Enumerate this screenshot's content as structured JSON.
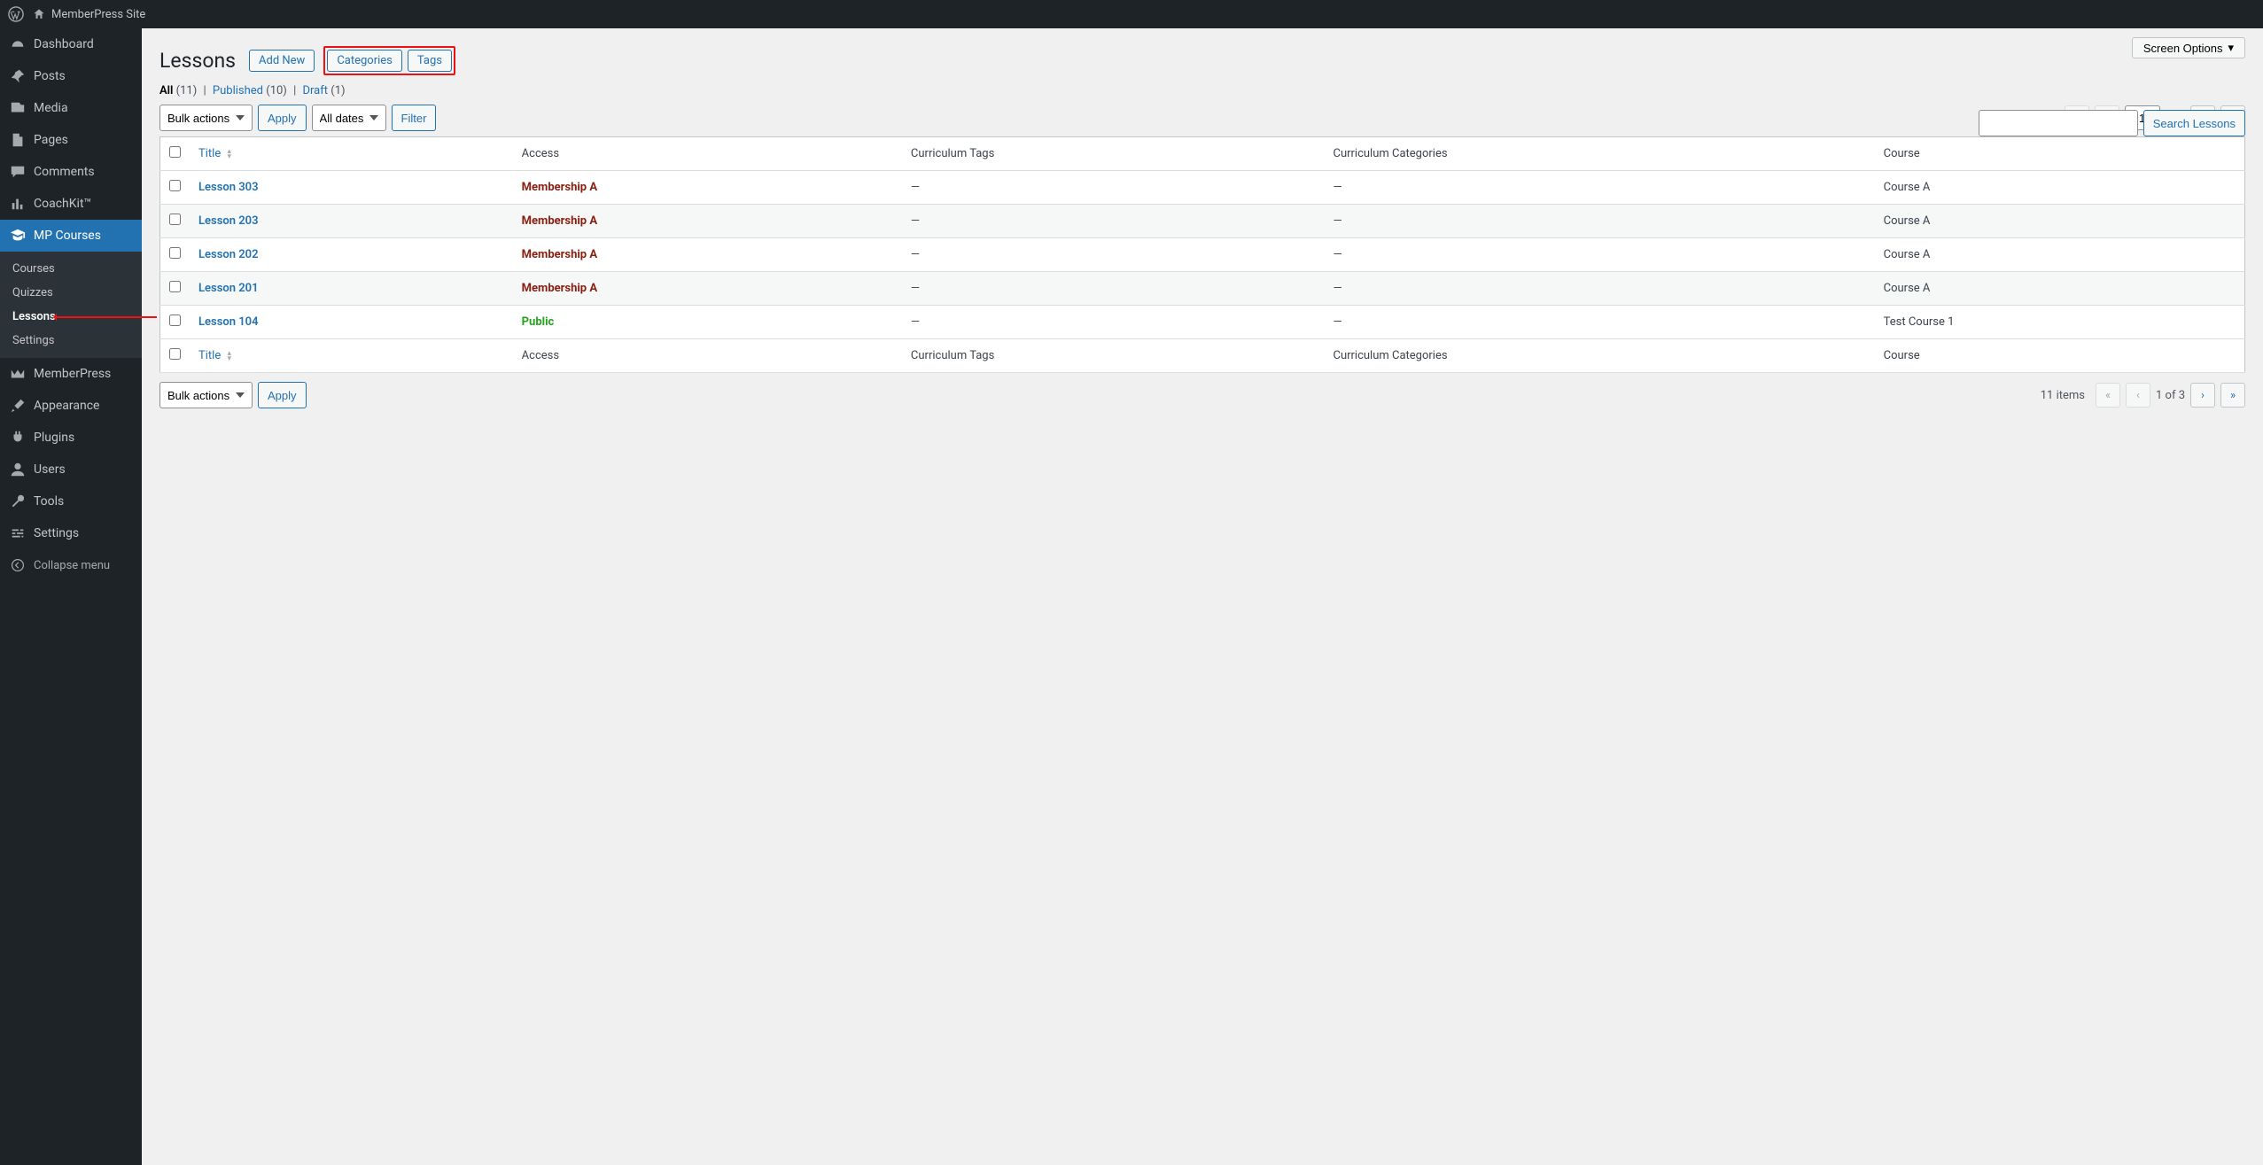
{
  "adminbar": {
    "site_name": "MemberPress Site"
  },
  "sidebar": {
    "items": [
      {
        "label": "Dashboard"
      },
      {
        "label": "Posts"
      },
      {
        "label": "Media"
      },
      {
        "label": "Pages"
      },
      {
        "label": "Comments"
      },
      {
        "label": "CoachKit™"
      },
      {
        "label": "MP Courses"
      },
      {
        "label": "MemberPress"
      },
      {
        "label": "Appearance"
      },
      {
        "label": "Plugins"
      },
      {
        "label": "Users"
      },
      {
        "label": "Tools"
      },
      {
        "label": "Settings"
      }
    ],
    "submenu": {
      "courses": "Courses",
      "quizzes": "Quizzes",
      "lessons": "Lessons",
      "settings": "Settings"
    },
    "collapse": "Collapse menu"
  },
  "screen_options": "Screen Options",
  "page": {
    "title": "Lessons",
    "add_new": "Add New",
    "categories": "Categories",
    "tags": "Tags"
  },
  "views": {
    "all_label": "All",
    "all_count": "(11)",
    "published_label": "Published",
    "published_count": "(10)",
    "draft_label": "Draft",
    "draft_count": "(1)"
  },
  "filters": {
    "bulk_actions": "Bulk actions",
    "apply": "Apply",
    "all_dates": "All dates",
    "filter": "Filter",
    "search_lessons": "Search Lessons"
  },
  "pagination": {
    "items_text": "11 items",
    "first": "«",
    "prev": "‹",
    "current": "1",
    "of_text": "of 3",
    "of_text_bottom": "1 of 3",
    "next": "›",
    "last": "»"
  },
  "columns": {
    "title": "Title",
    "access": "Access",
    "curriculum_tags": "Curriculum Tags",
    "curriculum_categories": "Curriculum Categories",
    "course": "Course"
  },
  "rows": [
    {
      "title": "Lesson 303",
      "access": "Membership A",
      "access_class": "membership",
      "tags": "—",
      "cats": "—",
      "course": "Course A"
    },
    {
      "title": "Lesson 203",
      "access": "Membership A",
      "access_class": "membership",
      "tags": "—",
      "cats": "—",
      "course": "Course A"
    },
    {
      "title": "Lesson 202",
      "access": "Membership A",
      "access_class": "membership",
      "tags": "—",
      "cats": "—",
      "course": "Course A"
    },
    {
      "title": "Lesson 201",
      "access": "Membership A",
      "access_class": "membership",
      "tags": "—",
      "cats": "—",
      "course": "Course A"
    },
    {
      "title": "Lesson 104",
      "access": "Public",
      "access_class": "public",
      "tags": "—",
      "cats": "—",
      "course": "Test Course 1"
    }
  ]
}
